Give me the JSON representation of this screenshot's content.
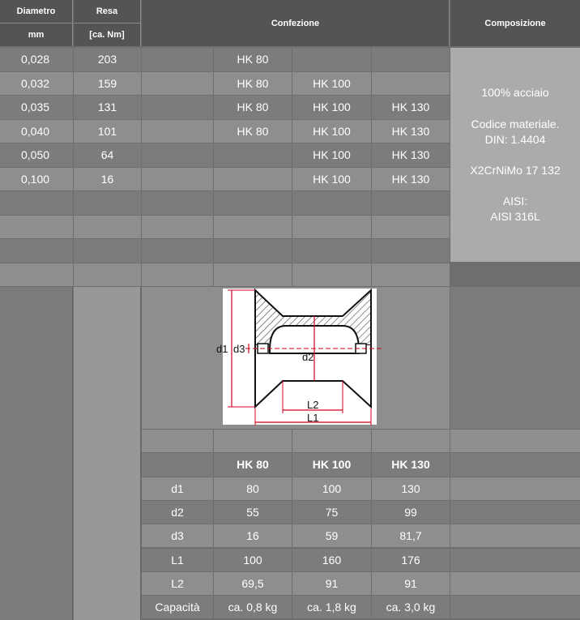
{
  "header": {
    "diameter": "Diametro",
    "diameter_unit": "mm",
    "yield": "Resa",
    "yield_unit": "[ca. Nm]",
    "package": "Confezione",
    "composition": "Composizione"
  },
  "rows": [
    {
      "diameter": "0,028",
      "yield": "203",
      "p1": "HK 80",
      "p2": "",
      "p3": ""
    },
    {
      "diameter": "0,032",
      "yield": "159",
      "p1": "HK 80",
      "p2": "HK 100",
      "p3": ""
    },
    {
      "diameter": "0,035",
      "yield": "131",
      "p1": "HK 80",
      "p2": "HK 100",
      "p3": "HK 130"
    },
    {
      "diameter": "0,040",
      "yield": "101",
      "p1": "HK 80",
      "p2": "HK 100",
      "p3": "HK 130"
    },
    {
      "diameter": "0,050",
      "yield": "64",
      "p1": "",
      "p2": "HK 100",
      "p3": "HK 130"
    },
    {
      "diameter": "0,100",
      "yield": "16",
      "p1": "",
      "p2": "HK 100",
      "p3": "HK 130"
    }
  ],
  "composition": {
    "line1": "100% acciaio",
    "line2": "Codice materiale.",
    "line3": "DIN: 1.4404",
    "line4": "X2CrNiMo 17 132",
    "line5": "AISI:",
    "line6": "AISI 316L"
  },
  "diagram": {
    "d1": "d1",
    "d3": "d3",
    "d2": "d2",
    "L2": "L2",
    "L1": "L1"
  },
  "spec": {
    "columns": [
      "HK 80",
      "HK 100",
      "HK 130"
    ],
    "rows": [
      {
        "label": "d1",
        "v": [
          "80",
          "100",
          "130"
        ]
      },
      {
        "label": "d2",
        "v": [
          "55",
          "75",
          "99"
        ]
      },
      {
        "label": "d3",
        "v": [
          "16",
          "59",
          "81,7"
        ]
      },
      {
        "label": "L1",
        "v": [
          "100",
          "160",
          "176"
        ]
      },
      {
        "label": "L2",
        "v": [
          "69,5",
          "91",
          "91"
        ]
      },
      {
        "label": "Capacità",
        "v": [
          "ca. 0,8 kg",
          "ca. 1,8 kg",
          "ca. 3,0 kg"
        ]
      }
    ]
  },
  "colors": {
    "header_bg": "#545454",
    "cell_dark": "#7c7c7c",
    "cell_light": "#8e8e8e",
    "composition_bg": "#ababab",
    "diagram_bg": "#ffffff",
    "dimension_red": "#d0021b"
  }
}
